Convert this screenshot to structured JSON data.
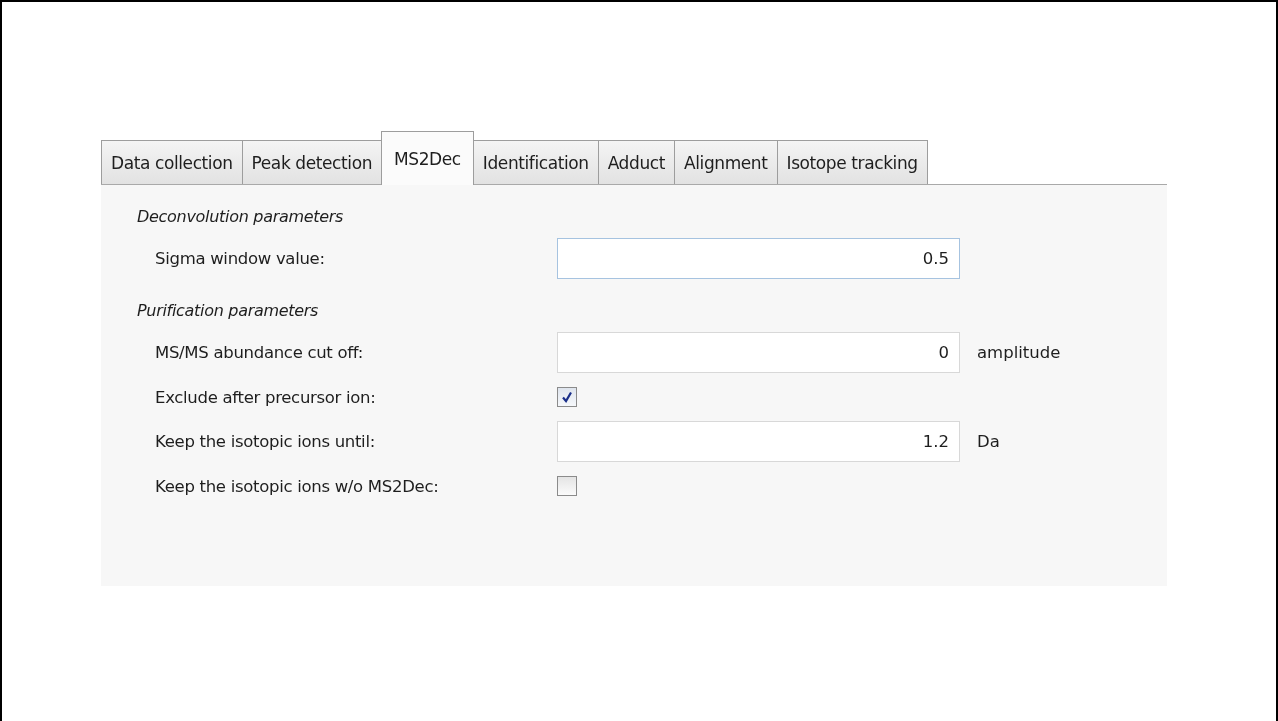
{
  "tabs": [
    {
      "label": "Data collection",
      "selected": false
    },
    {
      "label": "Peak detection",
      "selected": false
    },
    {
      "label": "MS2Dec",
      "selected": true
    },
    {
      "label": "Identification",
      "selected": false
    },
    {
      "label": "Adduct",
      "selected": false
    },
    {
      "label": "Alignment",
      "selected": false
    },
    {
      "label": "Isotope tracking",
      "selected": false
    }
  ],
  "sections": [
    {
      "title": "Deconvolution parameters",
      "rows": [
        {
          "kind": "field",
          "label": "Sigma window value:",
          "value": "0.5",
          "focused": true
        }
      ]
    },
    {
      "title": "Purification parameters",
      "rows": [
        {
          "kind": "field",
          "label": "MS/MS abundance cut off:",
          "value": "0",
          "focused": false,
          "unit": "amplitude"
        },
        {
          "kind": "checkbox",
          "label": "Exclude after precursor ion:",
          "checked": true
        },
        {
          "kind": "field",
          "label": "Keep the isotopic ions until:",
          "value": "1.2",
          "focused": false,
          "unit": "Da"
        },
        {
          "kind": "checkbox",
          "label": "Keep the isotopic ions w/o MS2Dec:",
          "checked": false
        }
      ]
    }
  ]
}
